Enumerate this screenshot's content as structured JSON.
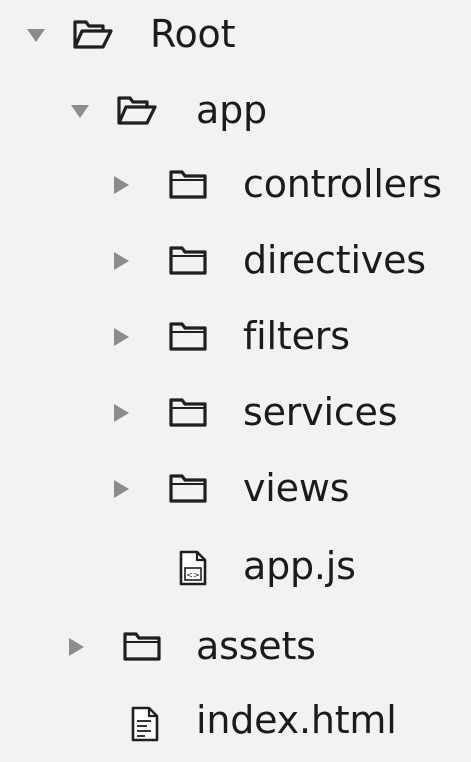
{
  "tree": {
    "root": {
      "label": "Root",
      "expanded": true,
      "icon": "folder-open-icon"
    },
    "app": {
      "label": "app",
      "expanded": true,
      "icon": "folder-open-icon",
      "children": [
        {
          "label": "controllers",
          "type": "folder",
          "expanded": false,
          "icon": "folder-icon"
        },
        {
          "label": "directives",
          "type": "folder",
          "expanded": false,
          "icon": "folder-icon"
        },
        {
          "label": "filters",
          "type": "folder",
          "expanded": false,
          "icon": "folder-icon"
        },
        {
          "label": "services",
          "type": "folder",
          "expanded": false,
          "icon": "folder-icon"
        },
        {
          "label": "views",
          "type": "folder",
          "expanded": false,
          "icon": "folder-icon"
        },
        {
          "label": "app.js",
          "type": "file",
          "icon": "js-file-icon"
        }
      ]
    },
    "assets": {
      "label": "assets",
      "type": "folder",
      "expanded": false,
      "icon": "folder-icon"
    },
    "index": {
      "label": "index.html",
      "type": "file",
      "icon": "html-file-icon"
    }
  },
  "colors": {
    "background": "#f2f2f2",
    "text": "#1b1b1b",
    "disclosure_triangle": "#8c8c8c",
    "icon_stroke": "#1f1f1f"
  }
}
